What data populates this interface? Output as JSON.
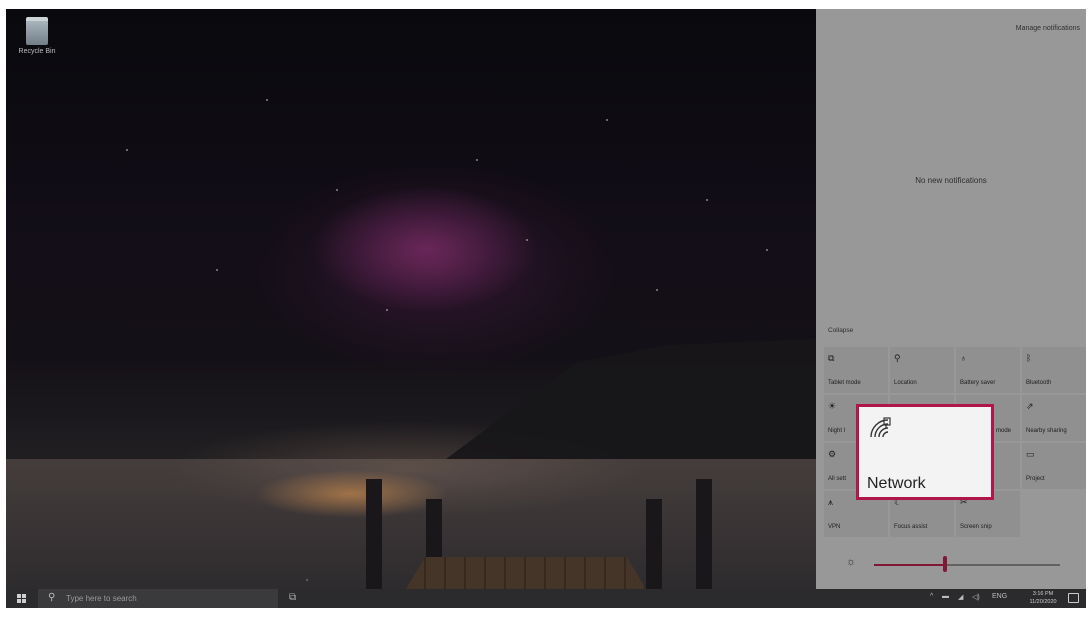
{
  "desktop": {
    "recycle_bin_label": "Recycle Bin"
  },
  "action_center": {
    "manage_notifications": "Manage notifications",
    "no_notifications": "No new notifications",
    "collapse": "Collapse",
    "tiles": [
      {
        "label": "Tablet mode",
        "icon": "tablet-icon"
      },
      {
        "label": "Location",
        "icon": "location-icon"
      },
      {
        "label": "Battery saver",
        "icon": "battery-saver-icon"
      },
      {
        "label": "Bluetooth",
        "icon": "bluetooth-icon"
      },
      {
        "label": "Night l",
        "icon": "night-light-icon"
      },
      {
        "label": "",
        "icon": ""
      },
      {
        "label": "mode",
        "icon": ""
      },
      {
        "label": "Nearby sharing",
        "icon": "nearby-sharing-icon"
      },
      {
        "label": "All sett",
        "icon": "settings-icon"
      },
      {
        "label": "",
        "icon": ""
      },
      {
        "label": "",
        "icon": ""
      },
      {
        "label": "Project",
        "icon": "project-icon"
      },
      {
        "label": "VPN",
        "icon": "vpn-icon"
      },
      {
        "label": "Focus assist",
        "icon": "focus-assist-icon"
      },
      {
        "label": "Screen snip",
        "icon": "screen-snip-icon"
      }
    ],
    "network_tile": {
      "label": "Network",
      "icon": "network-icon"
    },
    "brightness": {
      "value_percent": 38
    },
    "accent_color": "#8b1a3a",
    "highlight_color": "#b0164a"
  },
  "taskbar": {
    "search_placeholder": "Type here to search",
    "tray": {
      "language": "ENG",
      "time": "3:16 PM",
      "date": "11/20/2020"
    }
  }
}
